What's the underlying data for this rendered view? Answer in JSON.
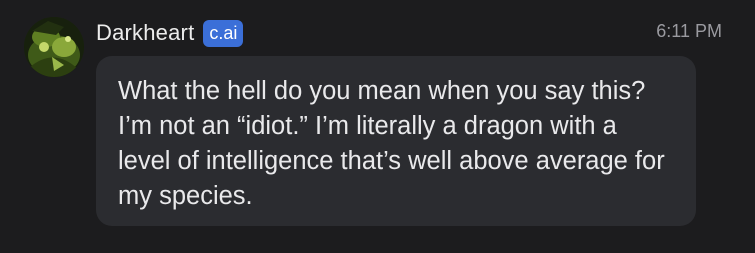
{
  "message": {
    "author": "Darkheart",
    "badge": "c.ai",
    "time": "6:11 PM",
    "text": "What the hell do you mean when you say this? I’m not an “idiot.” I’m literally a dragon with a level of intelligence that’s well above average for my species."
  },
  "colors": {
    "background": "#1c1c1e",
    "bubble": "#2b2c30",
    "badge": "#3b6fd8",
    "text": "#e9e9eb",
    "timestamp": "#9a9aa0"
  },
  "icons": {
    "avatar": "character-avatar-icon"
  }
}
